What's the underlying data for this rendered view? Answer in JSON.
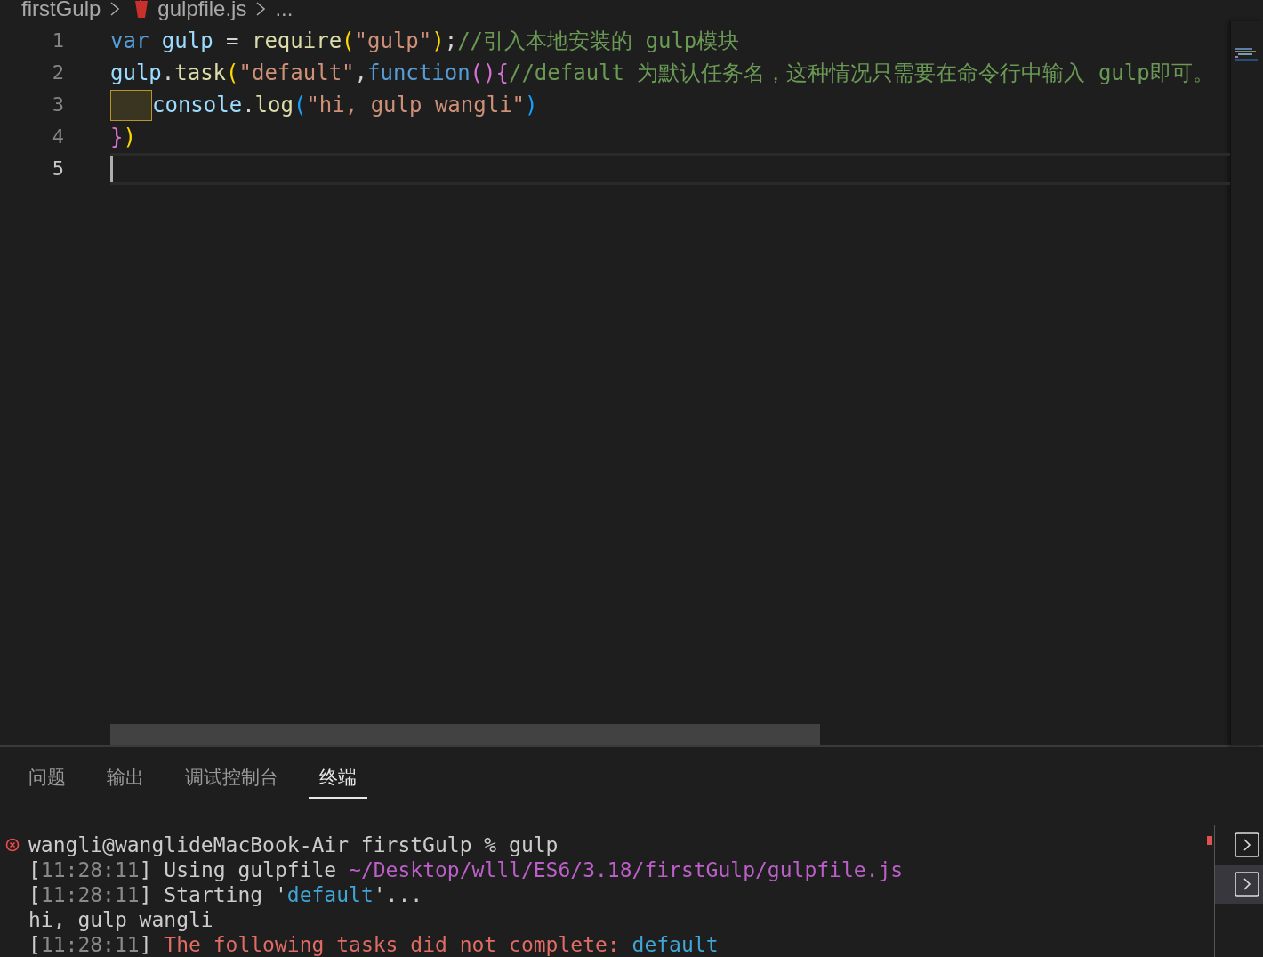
{
  "breadcrumb": [
    {
      "label": "firstGulp",
      "kind": "folder"
    },
    {
      "label": "gulpfile.js",
      "kind": "file"
    },
    {
      "label": "...",
      "kind": "more"
    }
  ],
  "editor": {
    "lines": [
      {
        "number": "1",
        "current": false,
        "indent_highlight": false,
        "tokens": [
          {
            "text": "var ",
            "kind": "keyword"
          },
          {
            "text": "gulp",
            "kind": "variable"
          },
          {
            "text": " = ",
            "kind": "punctuation"
          },
          {
            "text": "require",
            "kind": "function"
          },
          {
            "text": "(",
            "kind": "bracket",
            "color": "#ffd700"
          },
          {
            "text": "\"gulp\"",
            "kind": "string"
          },
          {
            "text": ")",
            "kind": "bracket",
            "color": "#ffd700"
          },
          {
            "text": ";",
            "kind": "punctuation"
          },
          {
            "text": "//引入本地安装的 gulp模块",
            "kind": "comment"
          }
        ]
      },
      {
        "number": "2",
        "current": false,
        "indent_highlight": false,
        "tokens": [
          {
            "text": "gulp",
            "kind": "variable"
          },
          {
            "text": ".",
            "kind": "punctuation"
          },
          {
            "text": "task",
            "kind": "function"
          },
          {
            "text": "(",
            "kind": "bracket",
            "color": "#ffd700"
          },
          {
            "text": "\"default\"",
            "kind": "string"
          },
          {
            "text": ",",
            "kind": "punctuation"
          },
          {
            "text": "function",
            "kind": "keyword"
          },
          {
            "text": "()",
            "kind": "bracket",
            "color": "#da70d6"
          },
          {
            "text": "{",
            "kind": "bracket",
            "color": "#da70d6"
          },
          {
            "text": "//default 为默认任务名，这种情况只需要在命令行中输入 gulp即可。",
            "kind": "comment"
          }
        ]
      },
      {
        "number": "3",
        "current": false,
        "indent_highlight": true,
        "tokens": [
          {
            "text": "console",
            "kind": "variable"
          },
          {
            "text": ".",
            "kind": "punctuation"
          },
          {
            "text": "log",
            "kind": "function"
          },
          {
            "text": "(",
            "kind": "bracket",
            "color": "#179fff"
          },
          {
            "text": "\"hi, gulp wangli\"",
            "kind": "string"
          },
          {
            "text": ")",
            "kind": "bracket",
            "color": "#179fff"
          }
        ]
      },
      {
        "number": "4",
        "current": false,
        "indent_highlight": false,
        "tokens": [
          {
            "text": "}",
            "kind": "bracket",
            "color": "#da70d6"
          },
          {
            "text": ")",
            "kind": "bracket",
            "color": "#ffd700"
          }
        ]
      },
      {
        "number": "5",
        "current": true,
        "indent_highlight": false
      }
    ]
  },
  "panel": {
    "tabs": [
      {
        "label": "问题",
        "selected": false
      },
      {
        "label": "输出",
        "selected": false
      },
      {
        "label": "调试控制台",
        "selected": false
      },
      {
        "label": "终端",
        "selected": true
      }
    ],
    "terminal": {
      "lines": [
        {
          "error": true,
          "segments": [
            {
              "text": "wangli@wanglideMacBook-Air firstGulp % gulp",
              "kind": "text"
            }
          ]
        },
        {
          "error": false,
          "segments": [
            {
              "text": "[",
              "kind": "text"
            },
            {
              "text": "11:28:11",
              "kind": "time"
            },
            {
              "text": "] Using gulpfile ",
              "kind": "text"
            },
            {
              "text": "~/Desktop/wlll/ES6/3.18/firstGulp/gulpfile.js",
              "kind": "path"
            }
          ]
        },
        {
          "error": false,
          "segments": [
            {
              "text": "[",
              "kind": "text"
            },
            {
              "text": "11:28:11",
              "kind": "time"
            },
            {
              "text": "] Starting '",
              "kind": "text"
            },
            {
              "text": "default",
              "kind": "name"
            },
            {
              "text": "'...",
              "kind": "text"
            }
          ]
        },
        {
          "error": false,
          "segments": [
            {
              "text": "hi, gulp wangli",
              "kind": "text"
            }
          ]
        },
        {
          "error": false,
          "segments": [
            {
              "text": "[",
              "kind": "text"
            },
            {
              "text": "11:28:11",
              "kind": "time"
            },
            {
              "text": "] ",
              "kind": "text"
            },
            {
              "text": "The following tasks did not complete: ",
              "kind": "error"
            },
            {
              "text": "default",
              "kind": "name"
            }
          ]
        }
      ]
    },
    "sessions": [
      {
        "selected": false
      },
      {
        "selected": true
      }
    ]
  }
}
